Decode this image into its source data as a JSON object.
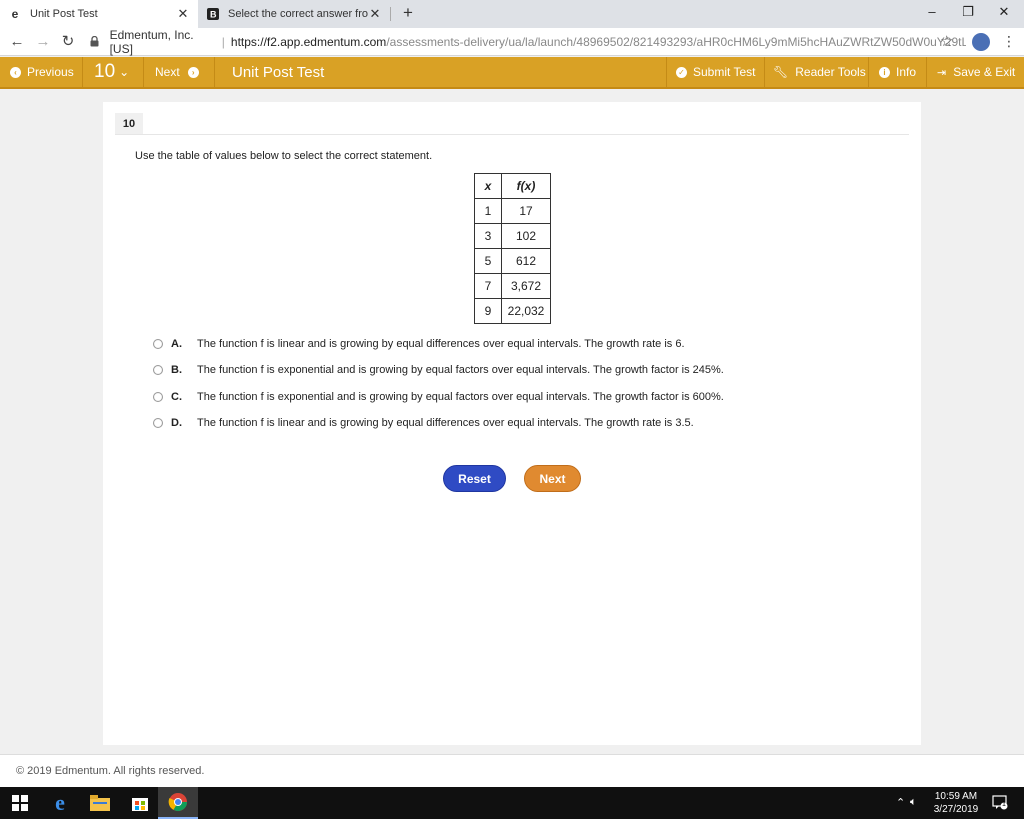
{
  "browser": {
    "tabs": [
      {
        "title": "Unit Post Test",
        "active": true
      },
      {
        "title": "Select the correct answer from e",
        "active": false
      }
    ],
    "new_tab": "+",
    "window_controls": {
      "minimize": "–",
      "restore": "❐",
      "close": "✕"
    },
    "site_identity": "Edmentum, Inc. [US]",
    "url_host": "https://f2.app.edmentum.com",
    "url_path": "/assessments-delivery/ua/la/launch/48969502/821493293/aHR0cHM6Ly9mMi5hcHAuZWRtZW50dW0uY29tL2x..."
  },
  "toolbar": {
    "previous_label": "Previous",
    "question_number": "10",
    "next_label": "Next",
    "test_title": "Unit Post Test",
    "submit_label": "Submit Test",
    "reader_tools_label": "Reader Tools",
    "info_label": "Info",
    "save_exit_label": "Save & Exit",
    "accent_color": "#d9a125"
  },
  "question": {
    "number": "10",
    "prompt": "Use the table of values below to select the correct statement.",
    "table": {
      "headers": [
        "x",
        "f(x)"
      ],
      "rows": [
        [
          "1",
          "17"
        ],
        [
          "3",
          "102"
        ],
        [
          "5",
          "612"
        ],
        [
          "7",
          "3,672"
        ],
        [
          "9",
          "22,032"
        ]
      ]
    },
    "options": [
      {
        "letter": "A.",
        "text": "The function f is linear and is growing by equal differences over equal intervals. The growth rate is 6."
      },
      {
        "letter": "B.",
        "text": "The function f is exponential and is growing by equal factors over equal intervals. The growth factor is 245%."
      },
      {
        "letter": "C.",
        "text": "The function f is exponential and is growing by equal factors over equal intervals. The growth factor is 600%."
      },
      {
        "letter": "D.",
        "text": "The function f is linear and is growing by equal differences over equal intervals. The growth rate is 3.5."
      }
    ],
    "reset_label": "Reset",
    "next_label": "Next"
  },
  "footer": {
    "copyright": "© 2019 Edmentum. All rights reserved."
  },
  "taskbar": {
    "time": "10:59 AM",
    "date": "3/27/2019",
    "notification_count": "1"
  }
}
